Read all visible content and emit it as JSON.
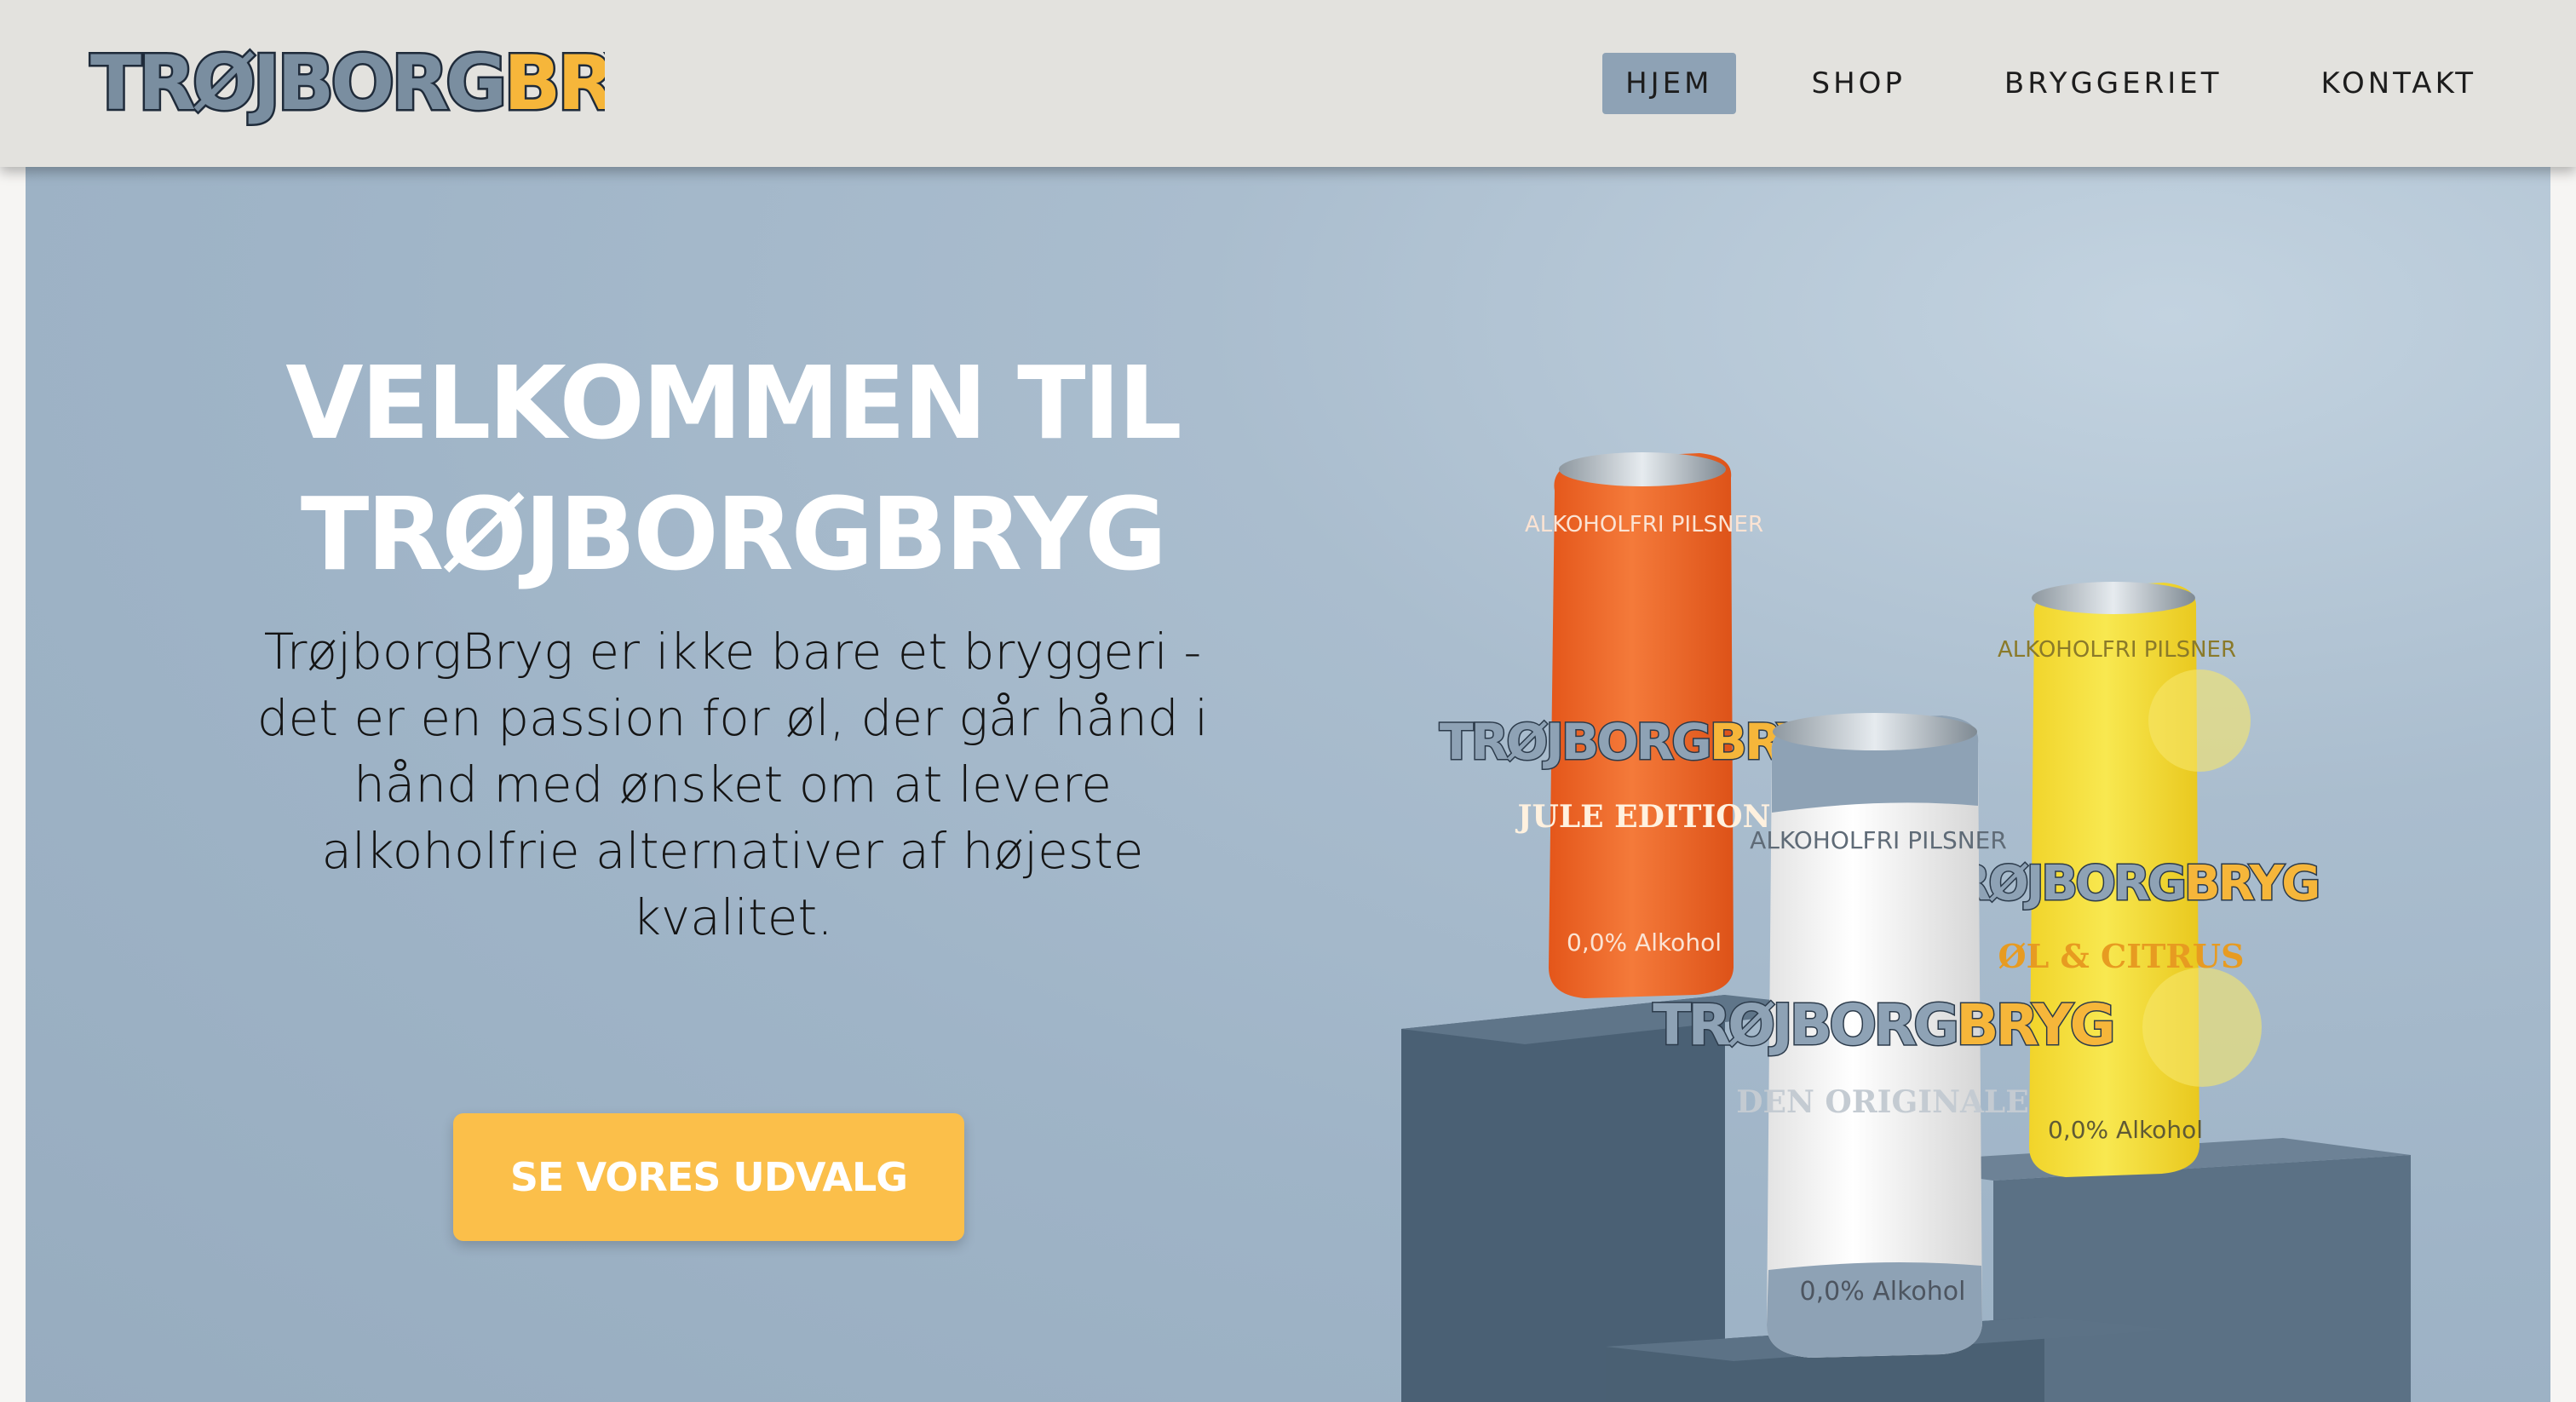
{
  "brand": {
    "logo_text_main": "TRØJBORG",
    "logo_text_accent": "BRYG",
    "colors": {
      "slate": "#7a8ea0",
      "yellow": "#f6b63a",
      "outline": "#1f2b3a"
    }
  },
  "nav": {
    "items": [
      {
        "label": "HJEM",
        "active": true
      },
      {
        "label": "SHOP",
        "active": false
      },
      {
        "label": "BRYGGERIET",
        "active": false
      },
      {
        "label": "KONTAKT",
        "active": false
      }
    ],
    "active_color": "#8ea2b5"
  },
  "hero": {
    "title_line1": "VELKOMMEN TIL",
    "title_line2": "TRØJBORGBRYG",
    "text": "TrøjborgBryg er ikke bare et bryggeri - det er en passion for øl, der går hånd i hånd med ønsket om at levere alkoholfrie alternativer af højeste kvalitet.",
    "cta_label": "SE VORES UDVALG",
    "cta_color": "#fbbf4a"
  },
  "cans": [
    {
      "top_label": "ALKOHOLFRI PILSNER",
      "brand_main": "TRØJBORG",
      "brand_accent": "BRYG",
      "edition": "JULE EDITION",
      "alcohol": "0,0% Alkohol",
      "color": "#f06a2a"
    },
    {
      "top_label": "ALKOHOLFRI PILSNER",
      "brand_main": "TRØJBORG",
      "brand_accent": "BRYG",
      "edition": "DEN ORIGINALE",
      "alcohol": "0,0% Alkohol",
      "color": "#f4f4f4"
    },
    {
      "top_label": "ALKOHOLFRI PILSNER",
      "brand_main": "TRØJBORG",
      "brand_accent": "BRYG",
      "edition": "ØL & CITRUS",
      "alcohol": "0,0% Alkohol",
      "color": "#f5e23a"
    }
  ]
}
